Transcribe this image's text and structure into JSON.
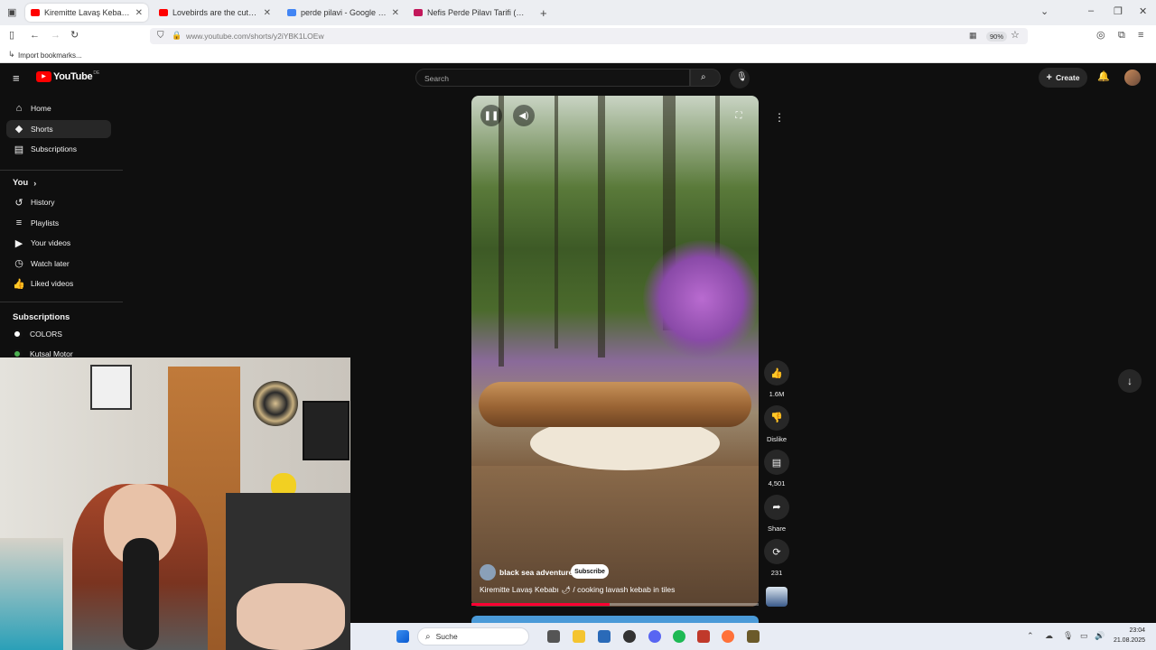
{
  "browser": {
    "tabs": [
      {
        "title": "Kiremitte Lavaş Kebabı 🌶",
        "favicon_color": "#ff0000",
        "active": true
      },
      {
        "title": "Lovebirds are the cutest birds",
        "favicon_color": "#ff0000",
        "active": false
      },
      {
        "title": "perde pilavi - Google Search",
        "favicon_color": "#4285f4",
        "active": false
      },
      {
        "title": "Nefis Perde Pilavı Tarifi (Resimli",
        "favicon_color": "#c2185b",
        "active": false
      }
    ],
    "url": "www.youtube.com/shorts/y2iYBK1LOEw",
    "zoom": "90%",
    "bookmarks_label": "Import bookmarks..."
  },
  "youtube": {
    "logo_text": "YouTube",
    "logo_region": "DE",
    "search_placeholder": "Search",
    "create_label": "Create",
    "sidebar": {
      "main": [
        {
          "label": "Home",
          "icon": "home-icon",
          "glyph": "⌂"
        },
        {
          "label": "Shorts",
          "icon": "shorts-icon",
          "glyph": "◆"
        },
        {
          "label": "Subscriptions",
          "icon": "subscriptions-icon",
          "glyph": "▤"
        }
      ],
      "you_header": "You",
      "you_items": [
        {
          "label": "History",
          "icon": "history-icon",
          "glyph": "↺"
        },
        {
          "label": "Playlists",
          "icon": "playlists-icon",
          "glyph": "≡"
        },
        {
          "label": "Your videos",
          "icon": "your-videos-icon",
          "glyph": "▶"
        },
        {
          "label": "Watch later",
          "icon": "watch-later-icon",
          "glyph": "◷"
        },
        {
          "label": "Liked videos",
          "icon": "liked-videos-icon",
          "glyph": "👍"
        }
      ],
      "subscriptions_header": "Subscriptions",
      "subscriptions": [
        {
          "label": "COLORS",
          "avatar_color": "#ffffff"
        },
        {
          "label": "Kutsal Motor",
          "avatar_color": "#4caf50"
        }
      ]
    },
    "short": {
      "channel": "black sea adventurer",
      "subscribe_label": "Subscribe",
      "title": "Kiremitte Lavaş Kebabı 🌶 / cooking lavash kebab in tiles",
      "progress": 0.48,
      "actions": [
        {
          "label": "1.6M",
          "icon": "like-icon",
          "glyph": "👍"
        },
        {
          "label": "Dislike",
          "icon": "dislike-icon",
          "glyph": "👎"
        },
        {
          "label": "4,501",
          "icon": "comments-icon",
          "glyph": "▤"
        },
        {
          "label": "Share",
          "icon": "share-icon",
          "glyph": "➦"
        },
        {
          "label": "231",
          "icon": "remix-icon",
          "glyph": "⟳"
        }
      ]
    }
  },
  "taskbar": {
    "search_label": "Suche",
    "time": "23:04",
    "date": "21.08.2025"
  }
}
